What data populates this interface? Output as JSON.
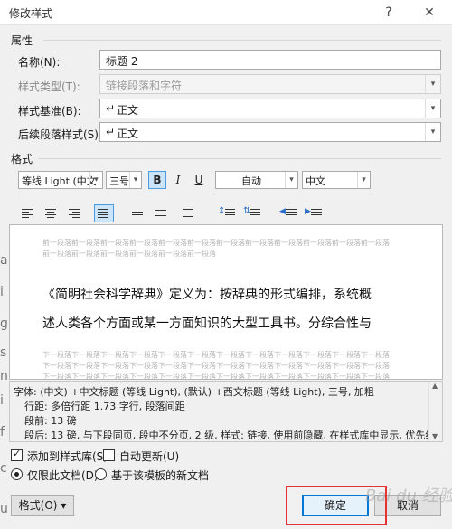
{
  "window": {
    "title": "修改样式",
    "help_label": "?",
    "close_label": "✕"
  },
  "properties": {
    "group_label": "属性",
    "name_label": "名称(N):",
    "name_value": "标题 2",
    "style_type_label": "样式类型(T):",
    "style_type_value": "链接段落和字符",
    "style_based_label": "样式基准(B):",
    "style_based_value": "正文",
    "next_style_label": "后续段落样式(S):",
    "next_style_value": "正文",
    "para_mark": "↵"
  },
  "format": {
    "group_label": "格式",
    "font_value": "等线 Light (中文",
    "size_value": "三号",
    "bold_label": "B",
    "italic_label": "I",
    "underline_label": "U",
    "color_value": "自动",
    "script_value": "中文"
  },
  "preview": {
    "prev_para_1": "前一段落前一段落前一段落前一段落前一段落前一段落前一段落前一段落前一段落前一段落前一段落前一段落",
    "prev_para_2": "前一段落前一段落前一段落前一段落前一段落前一段落",
    "sample_line_1": "《简明社会科学辞典》定义为：按辞典的形式编排，系统概",
    "sample_line_2": "述人类各个方面或某一方面知识的大型工具书。分综合性与",
    "next_para_1": "下一段落下一段落下一段落下一段落下一段落下一段落下一段落下一段落下一段落下一段落下一段落下一段落",
    "next_para_2": "下一段落下一段落下一段落下一段落下一段落下一段落下一段落下一段落下一段落下一段落下一段落下一段落",
    "next_para_3": "下一段落下一段落下一段落下一段落下一段落下一段落下一段落下一段落下一段落下一段落下一段落下一段落"
  },
  "description": {
    "line_1": "字体: (中文) +中文标题 (等线 Light), (默认) +西文标题 (等线 Light), 三号, 加粗",
    "line_2": "行距: 多倍行距 1.73 字行, 段落间距",
    "line_3": "段前: 13 磅",
    "line_4": "段后: 13 磅, 与下段同页, 段中不分页, 2 级, 样式: 链接, 使用前隐藏, 在样式库中显示, 优先级:"
  },
  "options": {
    "add_to_gallery": "添加到样式库(S)",
    "auto_update": "自动更新(U)",
    "only_this_doc": "仅限此文档(D)",
    "template_docs": "基于该模板的新文档"
  },
  "buttons": {
    "format": "格式(O) ▾",
    "ok": "确定",
    "cancel": "取消"
  },
  "watermark_text": "Bai du 经验",
  "background_chars": [
    "a",
    "i",
    "g",
    "s",
    "n",
    "i",
    "f",
    "c",
    "u"
  ],
  "colors": {
    "accent": "#0078d7",
    "highlight_box": "#e63232",
    "button_on": "#cce4f7"
  }
}
